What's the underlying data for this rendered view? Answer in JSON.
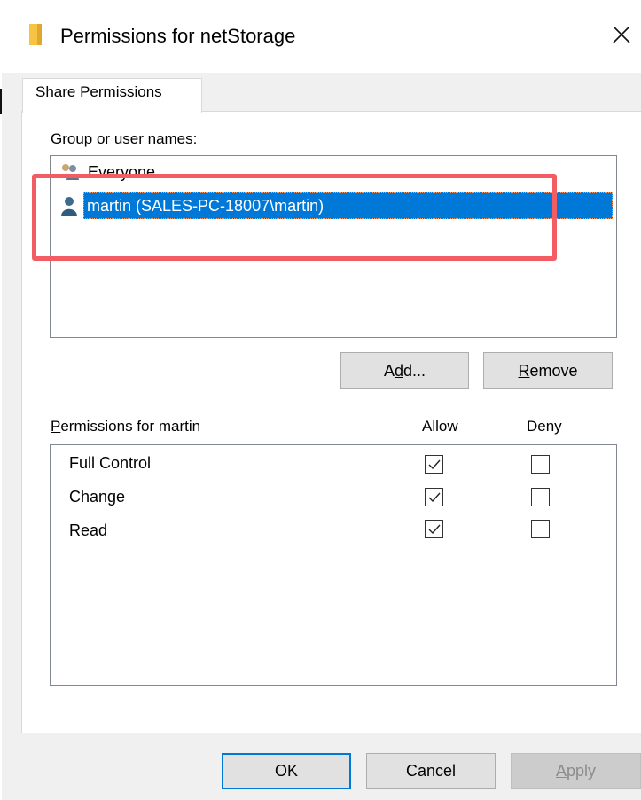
{
  "window": {
    "title": "Permissions for netStorage",
    "close_icon": "close-icon",
    "folder_icon": "folder-icon"
  },
  "tabs": [
    {
      "label": "Share Permissions",
      "selected": true
    }
  ],
  "users_section": {
    "label_accel": "G",
    "label_rest": "roup or user names:",
    "users": [
      {
        "name": "Everyone",
        "icon": "group-users-icon",
        "selected": false
      },
      {
        "name": "martin (SALES-PC-18007\\martin)",
        "icon": "user-icon",
        "selected": true
      }
    ],
    "add_pre": "A",
    "add_accel": "d",
    "add_post": "d...",
    "remove_accel": "R",
    "remove_rest": "emove"
  },
  "permissions_section": {
    "label_accel": "P",
    "label_rest": "ermissions for martin",
    "allow_header": "Allow",
    "deny_header": "Deny",
    "rows": [
      {
        "name": "Full Control",
        "allow": true,
        "deny": false
      },
      {
        "name": "Change",
        "allow": true,
        "deny": false
      },
      {
        "name": "Read",
        "allow": true,
        "deny": false
      }
    ]
  },
  "footer": {
    "ok_label": "OK",
    "cancel_label": "Cancel",
    "apply_accel": "A",
    "apply_rest": "pply",
    "apply_enabled": false
  },
  "colors": {
    "selection": "#0078d7",
    "highlight_box": "#f25d63",
    "dialog_bg": "#f0f0f0"
  }
}
